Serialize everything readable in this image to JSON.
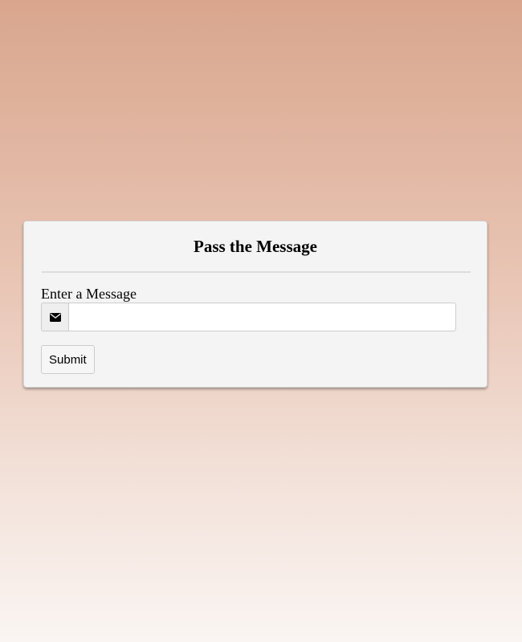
{
  "form": {
    "title": "Pass the Message",
    "field_label": "Enter a Message",
    "input_value": "",
    "input_placeholder": "",
    "input_icon": "envelope-icon",
    "submit_label": "Submit"
  },
  "colors": {
    "background_top": "#d9a68d",
    "background_bottom": "#faf5f2",
    "card_background": "#f4f4f4"
  }
}
